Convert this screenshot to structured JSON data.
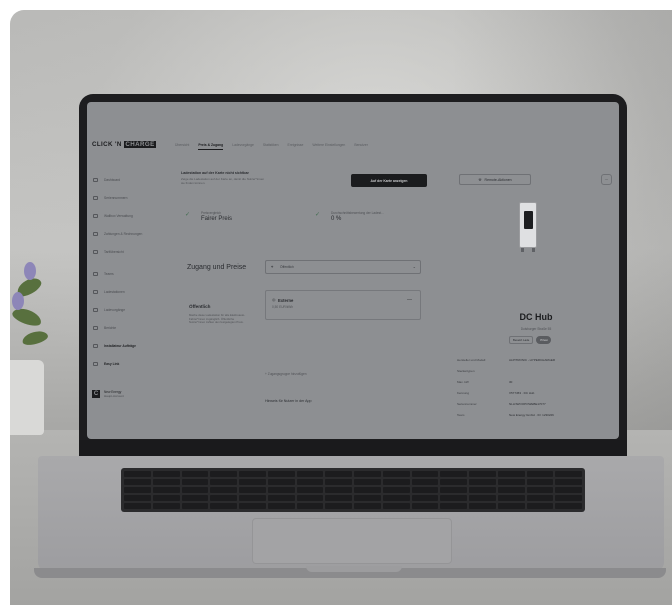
{
  "app": {
    "logo_prefix": "CLICK 'N",
    "logo_boxed": "CHARGE",
    "tabs": [
      "Übersicht",
      "Preis & Zugang",
      "Ladevorgänge",
      "Statistiken",
      "Ereignisse",
      "Weitere Einstellungen",
      "Benutzer"
    ],
    "active_tab": "Preis & Zugang"
  },
  "sidebar": {
    "items": [
      {
        "label": "Dashboard",
        "bold": false
      },
      {
        "label": "Seriennummern",
        "bold": false
      },
      {
        "label": "Wallbox Verwaltung",
        "bold": false
      },
      {
        "label": "Zahlungen & Rechnungen",
        "bold": false
      },
      {
        "label": "Tarifübersicht",
        "bold": false
      },
      {
        "label": "Teams",
        "bold": false
      },
      {
        "label": "Ladestationen",
        "bold": false
      },
      {
        "label": "Ladevorgänge",
        "bold": false
      },
      {
        "label": "Berichte",
        "bold": false
      },
      {
        "label": "Installateur Aufträge",
        "bold": true
      },
      {
        "label": "Easy Link",
        "bold": true
      }
    ],
    "footer": {
      "badge": "C",
      "name": "New Energy",
      "account": "Haupt-Account"
    }
  },
  "banner": {
    "heading": "Ladestation auf der Karte nicht sichtbar",
    "subtext": "Zeige die Ladestation auf der Karte an, damit die Nutzer*innen sie finden können.",
    "button_label": "Auf der Karte anzeigen"
  },
  "stats": [
    {
      "label": "Preisvergleich",
      "value": "Fairer Preis"
    },
    {
      "label": "Durchschnittsbewertung der Ladest...",
      "value": "0 %"
    }
  ],
  "access": {
    "section_title": "Zugang und Preise",
    "select_value": "Öffentlich",
    "access_title": "Öffentlich",
    "access_desc": "Mache diese Ladestation für alle Elektroauto-Fahrer*innen zugänglich. Öffentliche Nutzer*innen zahlen den festgelegten Preis.",
    "card_title": "Externe",
    "card_price": "0,50 EUR/kWh",
    "card_menu": "—",
    "add_label": "Zugangsgruppe hinzufügen",
    "hint_label": "Hinweis für Nutzer in der App"
  },
  "right_panel": {
    "remote_label": "Remote-Aktionen",
    "more_label": "···",
    "title": "DC Hub",
    "address": "Duisburger Straße 55",
    "chips": [
      {
        "label": "Besetzt Lade",
        "dark": false
      },
      {
        "label": "Privat",
        "dark": true
      }
    ],
    "details": [
      {
        "k": "Hersteller und Modell",
        "v": "ALPITRONIC - HYPERCHARGER"
      },
      {
        "k": "Steckertypen",
        "v": ""
      },
      {
        "k": "Max. kW",
        "v": "30"
      },
      {
        "k": "Kennung",
        "v": "X577453 · DC Hub"
      },
      {
        "k": "Seriennummer",
        "v": "NLLNWOOPOWEBE17077"
      },
      {
        "k": "Team",
        "v": "New Energy GmbH · ID: 1230226"
      }
    ]
  }
}
